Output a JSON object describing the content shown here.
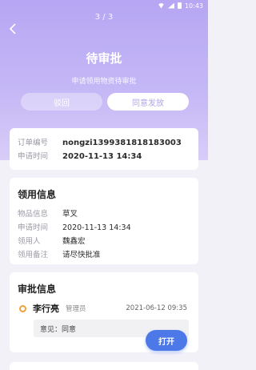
{
  "status_bar": {
    "time": "10:43"
  },
  "header": {
    "pager": "3 / 3",
    "title": "待审批",
    "subtitle": "申请领用物资待审批",
    "reject_label": "驳回",
    "approve_label": "同意发放"
  },
  "order": {
    "number_label": "订单编号",
    "number_value": "nongzi1399381818183003",
    "time_label": "申请时间",
    "time_value": "2020-11-13 14:34"
  },
  "usage": {
    "title": "领用信息",
    "rows": [
      {
        "label": "物品信息",
        "value": "草叉"
      },
      {
        "label": "申请时间",
        "value": "2020-11-13 14:34"
      },
      {
        "label": "领用人",
        "value": "魏鑫宏"
      },
      {
        "label": "领用备注",
        "value": "请尽快批准"
      }
    ]
  },
  "approval": {
    "title": "审批信息",
    "approver_name": "李行亮",
    "approver_role": "管理员",
    "approver_time": "2021-06-12 09:35",
    "opinion": "意见：同意",
    "open_label": "打开"
  },
  "colors": {
    "hero_top": "#b6a6f3",
    "accent_button": "#4d78e8",
    "status_dot": "#f4a03a"
  }
}
